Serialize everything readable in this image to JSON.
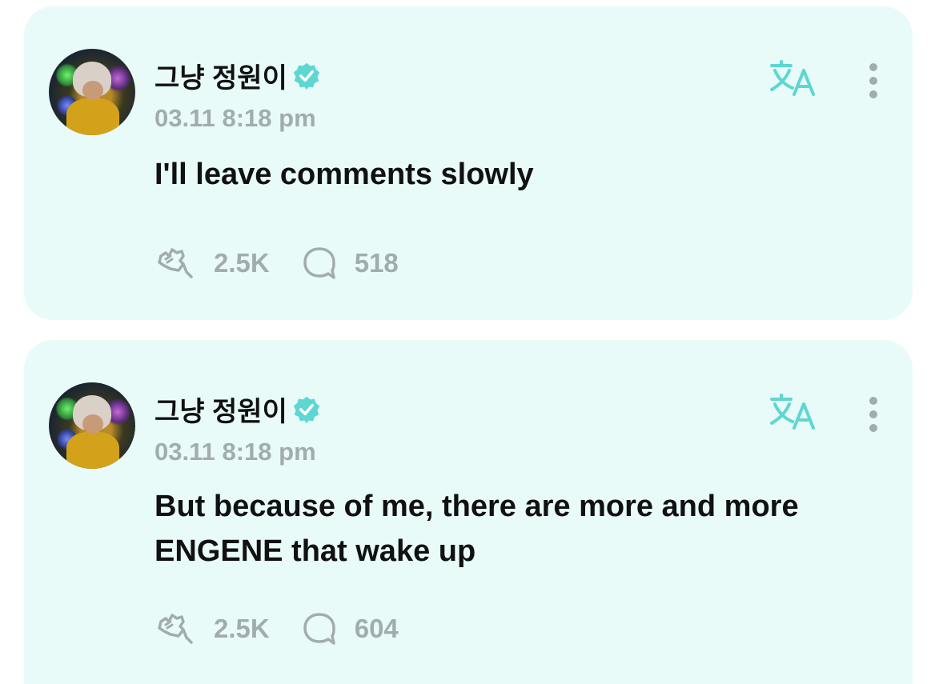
{
  "posts": [
    {
      "author": "그냥 정원이",
      "timestamp": "03.11 8:18 pm",
      "text": "I'll leave comments slowly",
      "likes": "2.5K",
      "comments": "518"
    },
    {
      "author": "그냥 정원이",
      "timestamp": "03.11 8:18 pm",
      "text": "But because of me, there are more and more ENGENE that wake up",
      "likes": "2.5K",
      "comments": "604"
    }
  ],
  "colors": {
    "card_bg": "#e9fbf9",
    "accent": "#5fd6d1",
    "muted_text": "#a1adad"
  },
  "icons": {
    "verified": "verified-badge-icon",
    "translate": "translate-icon",
    "more": "more-vertical-icon",
    "likes": "cheer-hand-icon",
    "comments": "comment-bubble-icon"
  }
}
